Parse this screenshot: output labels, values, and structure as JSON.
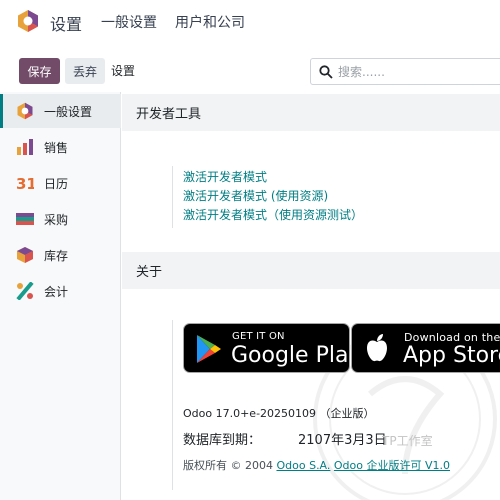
{
  "navbar": {
    "app_title": "设置",
    "menu": [
      "一般设置",
      "用户和公司"
    ]
  },
  "control_panel": {
    "save_label": "保存",
    "discard_label": "丢弃",
    "breadcrumb": "设置",
    "search_placeholder": "搜索......"
  },
  "sidebar": {
    "items": [
      {
        "label": "一般设置",
        "icon": "settings-app-icon",
        "active": true
      },
      {
        "label": "销售",
        "icon": "sales-app-icon"
      },
      {
        "label": "日历",
        "icon": "calendar-app-icon"
      },
      {
        "label": "采购",
        "icon": "purchase-app-icon"
      },
      {
        "label": "库存",
        "icon": "inventory-app-icon"
      },
      {
        "label": "会计",
        "icon": "accounting-app-icon"
      }
    ]
  },
  "developer_tools": {
    "title": "开发者工具",
    "links": [
      "激活开发者模式",
      "激活开发者模式 (使用资源)",
      "激活开发者模式（使用资源测试）"
    ]
  },
  "about": {
    "title": "关于",
    "google_play": {
      "small": "GET IT ON",
      "big": "Google Play"
    },
    "app_store": {
      "small": "Download on the",
      "big": "App Store"
    },
    "version": "Odoo 17.0+e-20250109 （企业版）",
    "expiry_label": "数据库到期：",
    "expiry_value": "2107年3月3日",
    "copyright_prefix": "版权所有 © 2004 ",
    "copyright_link1": "Odoo S.A.",
    "copyright_link2": "Odoo 企业版许可 V1.0"
  },
  "watermark_text": "TP工作室",
  "colors": {
    "primary": "#714b67",
    "link": "#017e84",
    "calendar_red": "#e36d33"
  }
}
